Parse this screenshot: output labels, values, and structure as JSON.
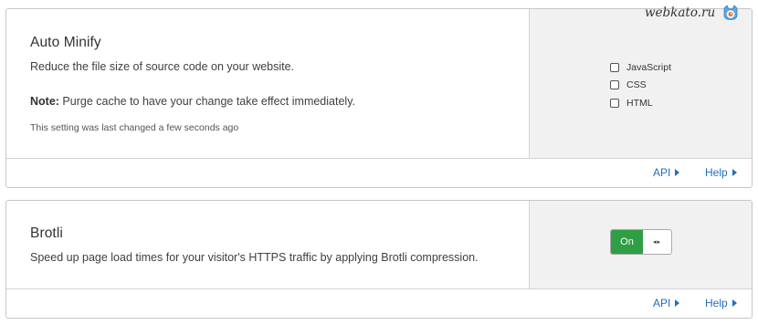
{
  "watermark": {
    "text": "webkato.ru",
    "logo_icon": "cat-head-icon"
  },
  "auto_minify": {
    "title": "Auto Minify",
    "description": "Reduce the file size of source code on your website.",
    "note_label": "Note:",
    "note_text": " Purge cache to have your change take effect immediately.",
    "meta": "This setting was last changed a few seconds ago",
    "options": [
      {
        "label": "JavaScript",
        "checked": false
      },
      {
        "label": "CSS",
        "checked": false
      },
      {
        "label": "HTML",
        "checked": false
      }
    ],
    "api_label": "API",
    "help_label": "Help"
  },
  "brotli": {
    "title": "Brotli",
    "description": "Speed up page load times for your visitor's HTTPS traffic by applying Brotli compression.",
    "toggle_on_label": "On",
    "toggle_handle_glyph": "◂▸",
    "toggle_state": "on",
    "api_label": "API",
    "help_label": "Help"
  },
  "colors": {
    "link": "#1f6ec0",
    "toggle_on": "#2f9e44",
    "panel_bg": "#f1f1f1",
    "border": "#c7c7c7"
  }
}
